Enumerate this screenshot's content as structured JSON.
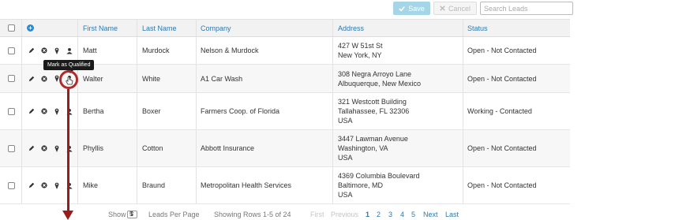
{
  "toolbar": {
    "save_label": "Save",
    "cancel_label": "Cancel",
    "search_placeholder": "Search Leads"
  },
  "table": {
    "headers": {
      "first_name": "First Name",
      "last_name": "Last Name",
      "company": "Company",
      "address": "Address",
      "status": "Status"
    },
    "rows": [
      {
        "first": "Matt",
        "last": "Murdock",
        "company": "Nelson & Murdock",
        "address": [
          "427 W 51st St",
          "New York, NY"
        ],
        "status": "Open - Not Contacted"
      },
      {
        "first": "Walter",
        "last": "White",
        "company": "A1 Car Wash",
        "address": [
          "308 Negra Arroyo Lane",
          "Albuquerque, New Mexico"
        ],
        "status": "Open - Not Contacted"
      },
      {
        "first": "Bertha",
        "last": "Boxer",
        "company": "Farmers Coop. of Florida",
        "address": [
          "321 Westcott Building",
          "Tallahassee, FL 32306",
          "USA"
        ],
        "status": "Working - Contacted"
      },
      {
        "first": "Phyllis",
        "last": "Cotton",
        "company": "Abbott Insurance",
        "address": [
          "3447 Lawman Avenue",
          "Washington, VA",
          "USA"
        ],
        "status": "Open - Not Contacted"
      },
      {
        "first": "Mike",
        "last": "Braund",
        "company": "Metropolitan Health Services",
        "address": [
          "4369 Columbia Boulevard",
          "Baltimore, MD",
          "USA"
        ],
        "status": "Open - Not Contacted"
      }
    ]
  },
  "tooltip": "Mark as Qualified",
  "pager": {
    "show_label": "Show",
    "per_page_value": "5",
    "per_page_suffix": "Leads Per Page",
    "rows_info": "Showing Rows 1-5 of 24",
    "first": "First",
    "previous": "Previous",
    "pages": [
      "1",
      "2",
      "3",
      "4",
      "5"
    ],
    "next": "Next",
    "last": "Last"
  },
  "icons": {
    "row_actions": [
      "pencil-icon",
      "delete-icon",
      "map-pin-icon",
      "user-icon"
    ],
    "header_add": "plus-circle-icon"
  },
  "colors": {
    "accent": "#2a7ab0",
    "save_button": "#a5d6e8",
    "annotation": "#9b1c1c"
  }
}
